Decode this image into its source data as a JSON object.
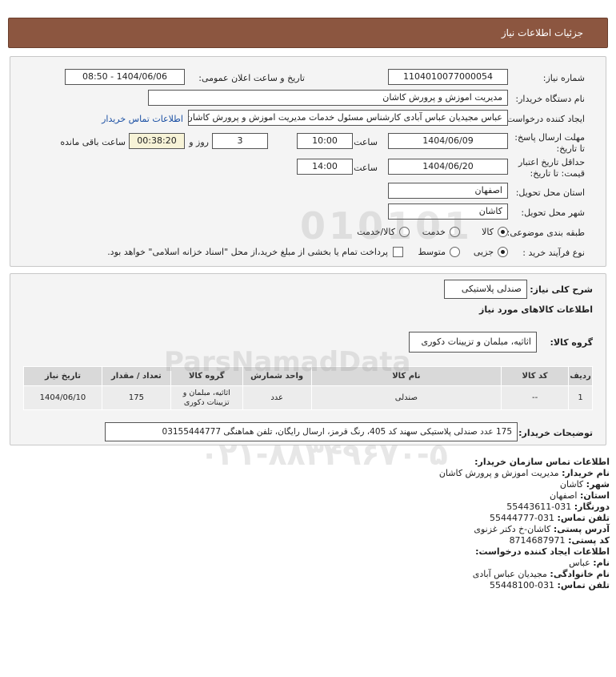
{
  "header": {
    "title": "جزئیات اطلاعات نیاز"
  },
  "form": {
    "need_number_label": "شماره نیاز:",
    "need_number": "1104010077000054",
    "announce_label": "تاریخ و ساعت اعلان عمومی:",
    "announce_value": "1404/06/06 - 08:50",
    "buyer_org_label": "نام دستگاه خریدار:",
    "buyer_org": "مدیریت اموزش و پرورش کاشان",
    "creator_label": "ایجاد کننده درخواست:",
    "creator": "عباس مجیدیان عباس آبادی کارشناس مسئول خدمات مدیریت اموزش و پرورش کاشان",
    "contact_link": "اطلاعات تماس خریدار",
    "deadline_label": "مهلت ارسال پاسخ: تا تاریخ:",
    "deadline_date": "1404/06/09",
    "time_label": "ساعت",
    "deadline_time": "10:00",
    "days_value": "3",
    "days_label": "روز و",
    "remaining_time": "00:38:20",
    "remaining_label": "ساعت باقی مانده",
    "validity_label": "حداقل تاریخ اعتبار قیمت: تا تاریخ:",
    "validity_date": "1404/06/20",
    "validity_time": "14:00",
    "province_label": "استان محل تحویل:",
    "province": "اصفهان",
    "city_label": "شهر محل تحویل:",
    "city": "کاشان",
    "category_label": "طبقه بندی موضوعی:",
    "category_options": [
      "کالا",
      "خدمت",
      "کالا/خدمت"
    ],
    "process_label": "نوع فرآیند خرید :",
    "process_options": [
      "جزیی",
      "متوسط"
    ],
    "payment_note": "پرداخت تمام یا بخشی از مبلغ خرید،از محل \"اسناد خزانه اسلامی\" خواهد بود."
  },
  "details": {
    "summary_label": "شرح کلی نیاز:",
    "summary": "صندلی پلاستیکی",
    "goods_info_title": "اطلاعات کالاهای مورد نیاز",
    "group_label": "گروه کالا:",
    "group": "اثاثیه، مبلمان و تزیینات دکوری",
    "table": {
      "headers": [
        "ردیف",
        "کد کالا",
        "نام کالا",
        "واحد شمارش",
        "گروه کالا",
        "تعداد / مقدار",
        "تاریخ نیاز"
      ],
      "rows": [
        [
          "1",
          "--",
          "صندلی",
          "عدد",
          "اثاثیه، مبلمان و تزیینات دکوری",
          "175",
          "1404/06/10"
        ]
      ]
    },
    "buyer_notes_label": "توضیحات خریدار:",
    "buyer_notes": "175 عدد صندلی پلاستیکی سهند کد 405، رنگ قرمز، ارسال رایگان، تلفن هماهنگی 03155444777"
  },
  "contact": {
    "title": "اطلاعات تماس سازمان خریدار:",
    "buyer_name_label": "نام خریدار:",
    "buyer_name": "مدیریت اموزش و پرورش کاشان",
    "city_label": "شهر:",
    "city": "کاشان",
    "province_label": "استان:",
    "province": "اصفهان",
    "fax_label": "دورنگار:",
    "fax": "031-55443611",
    "phone_label": "تلفن تماس:",
    "phone": "031-55444777",
    "address_label": "آدرس پستی:",
    "address": "کاشان-خ دکتر غزنوی",
    "postal_label": "کد پستی:",
    "postal": "8714687971",
    "creator_title": "اطلاعات ایجاد کننده درخواست:",
    "first_name_label": "نام:",
    "first_name": "عباس",
    "last_name_label": "نام خانوادگی:",
    "last_name": "مجیدیان عباس آبادی",
    "creator_phone_label": "تلفن تماس:",
    "creator_phone": "031-55448100"
  },
  "watermark": {
    "text1": "ParsNamadData",
    "text2": "۰۲۱-۸۸۳۴۹۶۷۰-۵",
    "text3": "010101"
  }
}
